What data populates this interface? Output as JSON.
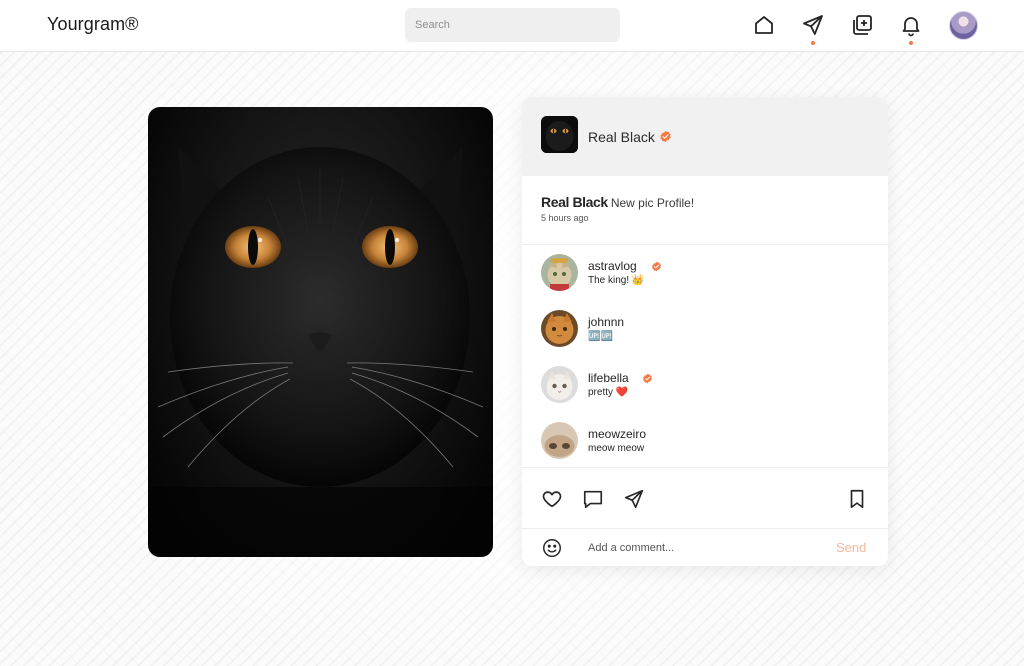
{
  "header": {
    "brand": "Yourgram®",
    "search_placeholder": "Search",
    "nav": {
      "home_icon": "home-icon",
      "messages_icon": "send-icon",
      "create_icon": "add-post-icon",
      "notifications_icon": "bell-icon",
      "dot_color": "#f27b45"
    }
  },
  "post": {
    "owner": {
      "name": "Real Black",
      "verified": true
    },
    "caption": {
      "user": "Real Black",
      "text": "New pic Profile!",
      "time": "5 hours ago"
    },
    "comments": [
      {
        "user": "astravlog",
        "verified": true,
        "text": "The king! 👑"
      },
      {
        "user": "johnnn",
        "verified": false,
        "text": "🆙🆙"
      },
      {
        "user": "lifebella",
        "verified": true,
        "text": "pretty ❤️"
      },
      {
        "user": "meowzeiro",
        "verified": false,
        "text": "meow meow"
      }
    ],
    "actions": [
      "heart-icon",
      "comment-icon",
      "share-icon",
      "bookmark-icon"
    ],
    "comment_box": {
      "placeholder": "Add a comment...",
      "send_label": "Send"
    }
  },
  "colors": {
    "accent": "#f27b45",
    "verified_badge": "#f27b45",
    "send_disabled": "#f4b89a"
  }
}
